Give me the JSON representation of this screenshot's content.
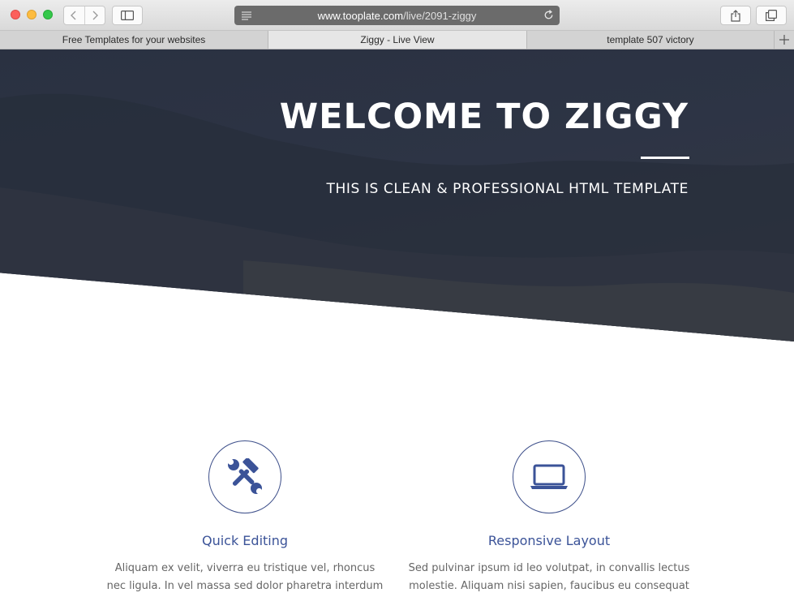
{
  "browser": {
    "url_host": "www.tooplate.com",
    "url_path": "/live/2091-ziggy",
    "tabs": [
      {
        "label": "Free Templates for your websites",
        "active": false
      },
      {
        "label": "Ziggy - Live View",
        "active": true
      },
      {
        "label": "template 507 victory",
        "active": false
      }
    ],
    "icons": {
      "back": "chevron-left-icon",
      "forward": "chevron-right-icon",
      "sidebar": "sidebar-icon",
      "reader": "reader-icon",
      "reload": "reload-icon",
      "share": "share-icon",
      "tabs": "tab-overview-icon",
      "new_tab": "plus-icon"
    }
  },
  "hero": {
    "title": "WELCOME TO ZIGGY",
    "subtitle": "THIS IS CLEAN & PROFESSIONAL HTML TEMPLATE"
  },
  "features": [
    {
      "icon": "tools-icon",
      "title": "Quick Editing",
      "text": "Aliquam ex velit, viverra eu tristique vel, rhoncus nec ligula. In vel massa sed dolor pharetra interdum vitae"
    },
    {
      "icon": "laptop-icon",
      "title": "Responsive Layout",
      "text": "Sed pulvinar ipsum id leo volutpat, in convallis lectus molestie. Aliquam nisi sapien, faucibus eu consequat id,"
    }
  ],
  "colors": {
    "hero_bg": "#2d3445",
    "accent": "#3b5398",
    "body_text": "#666666"
  }
}
